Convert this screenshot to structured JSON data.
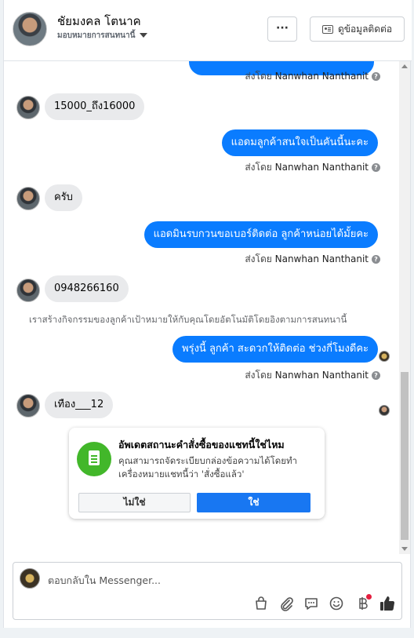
{
  "header": {
    "name": "ชัยมงคล โตนาค",
    "subtitle": "มอบหมายการสนทนานี้",
    "more_label": "···",
    "contact_button": "ดูข้อมูลติดต่อ"
  },
  "messages": {
    "sent_by_prefix": "ส่งโดย",
    "sender": "Nanwhan Nanthanit",
    "help_icon": "?",
    "in_1": "15000_ถึง16000",
    "out_1": "แอดมลูกค้าสนใจเป็นคันนี้นะคะ",
    "in_2": "ครับ",
    "out_2": "แอดมินรบกวนขอเบอร์ติดต่อ ลูกค้าหน่อยได้มั้ยคะ",
    "in_3": "0948266160",
    "system_note": "เราสร้างกิจกรรมของลูกค้าเป้าหมายให้กับคุณโดยอัตโนมัติโดยอิงตามการสนทนานี้",
    "out_3": "พรุ่งนี้ ลูกค้า สะดวกให้ติดต่อ ช่วงกี่โมงดีคะ",
    "in_4": "เทือง___12"
  },
  "status_card": {
    "title": "อัพเดตสถานะคำสั่งซื้อของแชทนี้ใช่ไหม",
    "body": "คุณสามารถจัดระเบียบกล่องข้อความได้โดยทำเครื่องหมายแชทนี้ว่า 'สั่งซื้อแล้ว'",
    "no_label": "ไม่ใช่",
    "yes_label": "ใช่"
  },
  "composer": {
    "placeholder": "ตอบกลับใน Messenger..."
  },
  "toolbar_icons": [
    "bag-icon",
    "paperclip-icon",
    "chat-bubble-icon",
    "emoji-icon",
    "baht-icon",
    "thumbs-up-icon"
  ],
  "colors": {
    "accent": "#1877f2",
    "bubble_out": "#0a7cff",
    "bubble_in": "#e9eaec",
    "card_icon": "#42b72a",
    "notification_dot": "#e41e3f"
  }
}
